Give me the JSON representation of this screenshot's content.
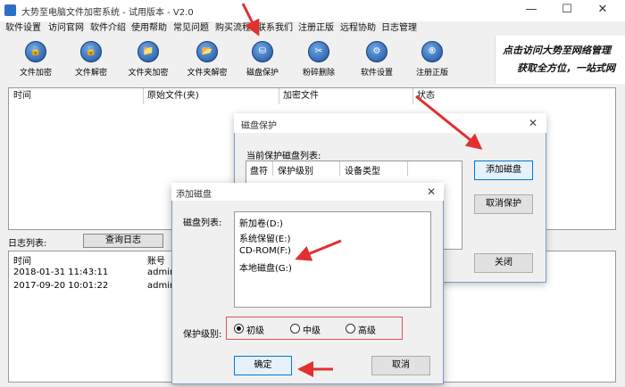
{
  "app": {
    "title": "大势至电脑文件加密系统 - 试用版本 - V2.0"
  },
  "window_controls": {
    "minimize": "—",
    "maximize": "☐",
    "close": "✕"
  },
  "menu": [
    "软件设置",
    "访问官网",
    "软件介绍",
    "使用帮助",
    "常见问题",
    "购买流程",
    "联系我们",
    "注册正版",
    "远程协助",
    "日志管理"
  ],
  "toolbar": [
    {
      "label": "文件加密",
      "icon": "lock-file-icon"
    },
    {
      "label": "文件解密",
      "icon": "unlock-file-icon"
    },
    {
      "label": "文件夹加密",
      "icon": "lock-folder-icon"
    },
    {
      "label": "文件夹解密",
      "icon": "unlock-folder-icon"
    },
    {
      "label": "磁盘保护",
      "icon": "disk-protect-icon"
    },
    {
      "label": "粉碎删除",
      "icon": "shred-icon"
    },
    {
      "label": "软件设置",
      "icon": "settings-icon"
    },
    {
      "label": "注册正版",
      "icon": "register-icon"
    }
  ],
  "promo": {
    "line1": "点击访问大势至网络管理",
    "line2": "获取全方位，一站式网"
  },
  "file_table": {
    "columns": [
      "时间",
      "原始文件(夹)",
      "加密文件",
      "状态"
    ]
  },
  "log": {
    "label": "日志列表:",
    "query_button": "查询日志",
    "columns": [
      "时间",
      "账号"
    ],
    "rows": [
      {
        "time": "2018-01-31 11:43:11",
        "account": "admin"
      },
      {
        "time": "2017-09-20 10:01:22",
        "account": "admin"
      }
    ]
  },
  "protect_dialog": {
    "title": "磁盘保护",
    "close": "✕",
    "list_label": "当前保护磁盘列表:",
    "columns": [
      "盘符",
      "保护级别",
      "设备类型"
    ],
    "add_button": "添加磁盘",
    "cancel_protect_button": "取消保护",
    "close_button": "关闭"
  },
  "add_dialog": {
    "title": "添加磁盘",
    "close": "✕",
    "list_label": "磁盘列表:",
    "disks": [
      "新加卷(D:)",
      "系统保留(E:)",
      "CD-ROM(F:)",
      "本地磁盘(G:)"
    ],
    "level_label": "保护级别:",
    "levels": [
      {
        "label": "初级",
        "selected": true
      },
      {
        "label": "中级",
        "selected": false
      },
      {
        "label": "高级",
        "selected": false
      }
    ],
    "ok_button": "确定",
    "cancel_button": "取消"
  },
  "colors": {
    "accent": "#0078d7",
    "annotation": "#e03030",
    "icon_blue": "#1b4f9a"
  }
}
